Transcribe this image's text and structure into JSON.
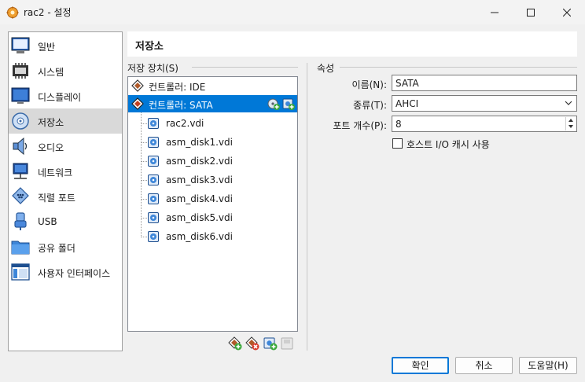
{
  "window": {
    "title": "rac2 - 설정"
  },
  "sidebar": {
    "items": [
      {
        "label": "일반",
        "icon": "general-icon"
      },
      {
        "label": "시스템",
        "icon": "system-chip-icon"
      },
      {
        "label": "디스플레이",
        "icon": "display-monitor-icon"
      },
      {
        "label": "저장소",
        "icon": "storage-disc-icon",
        "selected": true
      },
      {
        "label": "오디오",
        "icon": "speaker-icon"
      },
      {
        "label": "네트워크",
        "icon": "network-icon"
      },
      {
        "label": "직렬 포트",
        "icon": "serial-port-icon"
      },
      {
        "label": "USB",
        "icon": "usb-icon"
      },
      {
        "label": "공유 폴더",
        "icon": "folder-icon"
      },
      {
        "label": "사용자 인터페이스",
        "icon": "user-interface-icon"
      }
    ]
  },
  "header": {
    "title": "저장소"
  },
  "storage_devices": {
    "label": "저장 장치(S)",
    "tree": [
      {
        "label": "컨트롤러: IDE",
        "kind": "controller",
        "icon": "ide-controller-icon"
      },
      {
        "label": "컨트롤러: SATA",
        "kind": "controller",
        "icon": "sata-controller-icon",
        "selected": true
      },
      {
        "label": "rac2.vdi",
        "kind": "disk",
        "icon": "hard-disk-icon"
      },
      {
        "label": "asm_disk1.vdi",
        "kind": "disk",
        "icon": "hard-disk-icon"
      },
      {
        "label": "asm_disk2.vdi",
        "kind": "disk",
        "icon": "hard-disk-icon"
      },
      {
        "label": "asm_disk3.vdi",
        "kind": "disk",
        "icon": "hard-disk-icon"
      },
      {
        "label": "asm_disk4.vdi",
        "kind": "disk",
        "icon": "hard-disk-icon"
      },
      {
        "label": "asm_disk5.vdi",
        "kind": "disk",
        "icon": "hard-disk-icon"
      },
      {
        "label": "asm_disk6.vdi",
        "kind": "disk",
        "icon": "hard-disk-icon"
      }
    ],
    "toolbar": [
      "add-controller-icon",
      "remove-controller-icon",
      "add-attachment-icon",
      "remove-attachment-icon"
    ]
  },
  "attributes": {
    "label": "속성",
    "name_label": "이름(N):",
    "name_value": "SATA",
    "type_label": "종류(T):",
    "type_value": "AHCI",
    "port_label": "포트 개수(P):",
    "port_value": "8",
    "cache_label": "호스트 I/O 캐시 사용",
    "cache_checked": false
  },
  "buttons": {
    "ok": "확인",
    "cancel": "취소",
    "help": "도움말(H)"
  },
  "colors": {
    "selection": "#0078d7",
    "sidebar_selected": "#d9d9d9"
  }
}
